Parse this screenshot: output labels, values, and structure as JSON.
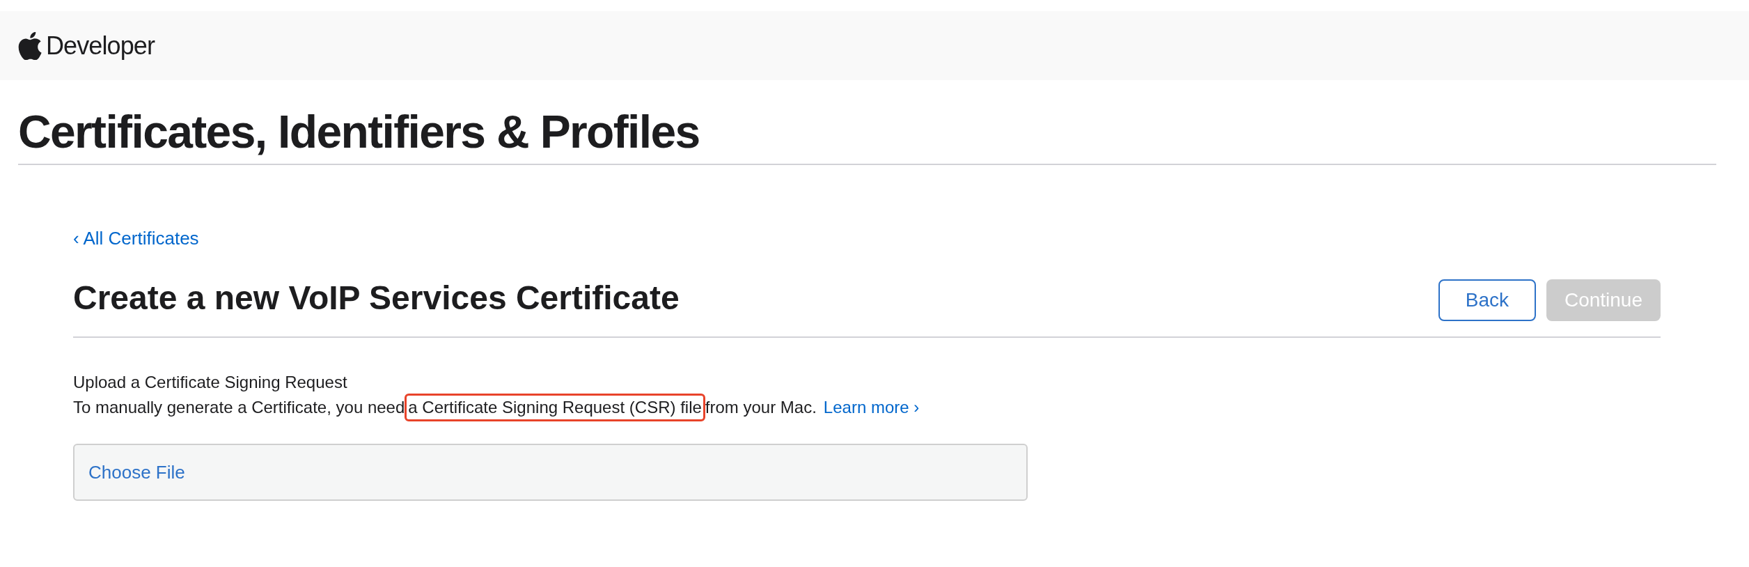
{
  "header": {
    "brand": "Developer"
  },
  "page_title": "Certificates, Identifiers & Profiles",
  "back_link": "‹ All Certificates",
  "heading": "Create a new VoIP Services Certificate",
  "buttons": [
    {
      "label": "Back",
      "disabled": false
    },
    {
      "label": "Continue",
      "disabled": true
    }
  ],
  "section": {
    "title": "Upload a Certificate Signing Request",
    "text_before": "To manually generate a Certificate, you need ",
    "text_highlighted": "a Certificate Signing Request (CSR) file",
    "text_after": " from your Mac.",
    "link": "Learn more ›"
  },
  "file_field": {
    "label": "Choose File"
  }
}
